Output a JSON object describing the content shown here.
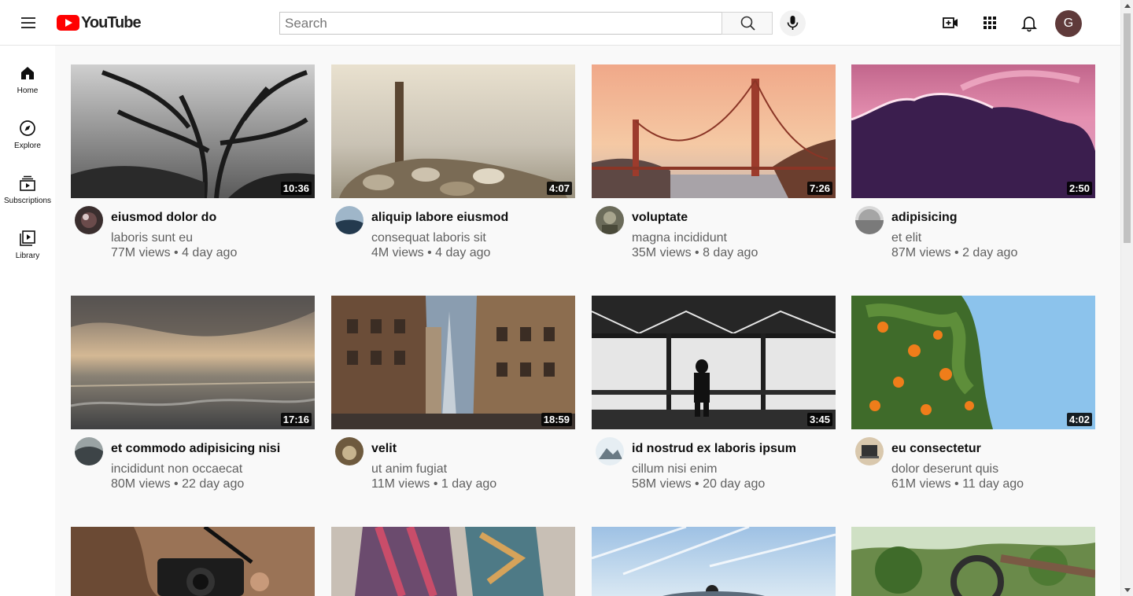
{
  "header": {
    "logo_text": "YouTube",
    "search_placeholder": "Search",
    "avatar_letter": "G",
    "icons": [
      "menu-icon",
      "search-icon",
      "mic-icon",
      "create-video-icon",
      "apps-grid-icon",
      "notifications-bell-icon"
    ]
  },
  "sidebar": {
    "items": [
      {
        "label": "Home",
        "icon": "home-icon"
      },
      {
        "label": "Explore",
        "icon": "compass-icon"
      },
      {
        "label": "Subscriptions",
        "icon": "subscriptions-icon"
      },
      {
        "label": "Library",
        "icon": "library-icon"
      }
    ]
  },
  "videos": [
    {
      "title": "eiusmod dolor do",
      "channel": "laboris sunt eu",
      "meta": "77M views • 4 day ago",
      "duration": "10:36"
    },
    {
      "title": "aliquip labore eiusmod",
      "channel": "consequat laboris sit",
      "meta": "4M views • 4 day ago",
      "duration": "4:07"
    },
    {
      "title": "voluptate",
      "channel": "magna incididunt",
      "meta": "35M views • 8 day ago",
      "duration": "7:26"
    },
    {
      "title": "adipisicing",
      "channel": "et elit",
      "meta": "87M views • 2 day ago",
      "duration": "2:50"
    },
    {
      "title": "et commodo adipisicing nisi",
      "channel": "incididunt non occaecat",
      "meta": "80M views • 22 day ago",
      "duration": "17:16"
    },
    {
      "title": "velit",
      "channel": "ut anim fugiat",
      "meta": "11M views • 1 day ago",
      "duration": "18:59"
    },
    {
      "title": "id nostrud ex laboris ipsum",
      "channel": "cillum nisi enim",
      "meta": "58M views • 20 day ago",
      "duration": "3:45"
    },
    {
      "title": "eu consectetur",
      "channel": "dolor deserunt quis",
      "meta": "61M views • 11 day ago",
      "duration": "4:02"
    }
  ],
  "colors": {
    "brand_red": "#ff0000",
    "page_bg": "#f9f9f9",
    "secondary_text": "#606060"
  }
}
